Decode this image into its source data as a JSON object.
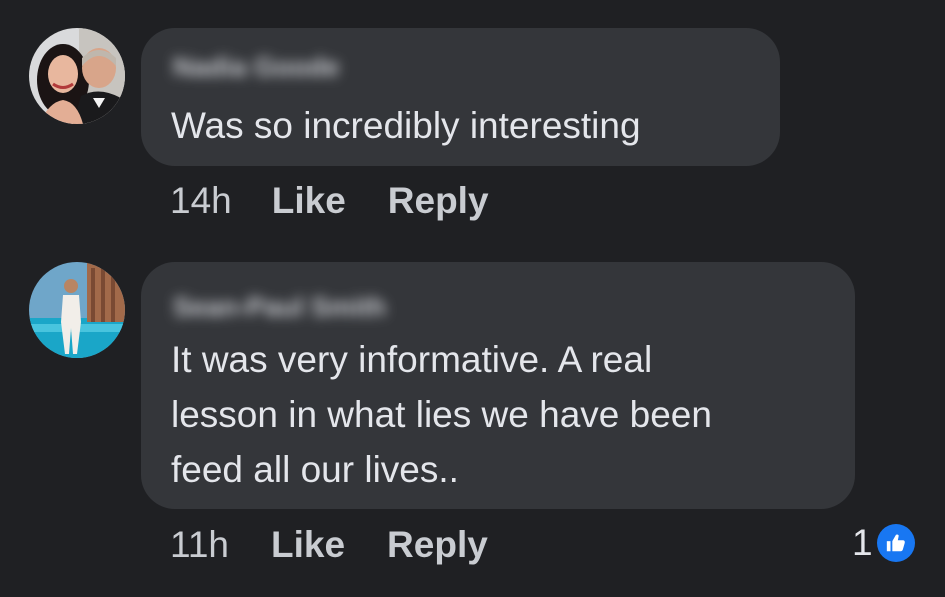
{
  "comments": [
    {
      "author": "Nadia Goode",
      "text": "Was so incredibly interesting",
      "time": "14h",
      "like_label": "Like",
      "reply_label": "Reply"
    },
    {
      "author": "Sean-Paul Smith",
      "text": "It was very informative. A real\nlesson in what lies we have been\nfeed all our lives..",
      "time": "11h",
      "like_label": "Like",
      "reply_label": "Reply",
      "reaction_count": "1",
      "reaction_icon": "thumbs-up-icon"
    }
  ],
  "colors": {
    "background": "#1f2023",
    "bubble": "#34363a",
    "text": "#e4e6eb",
    "meta": "#b0b3b8",
    "like_accent": "#1877f2"
  }
}
